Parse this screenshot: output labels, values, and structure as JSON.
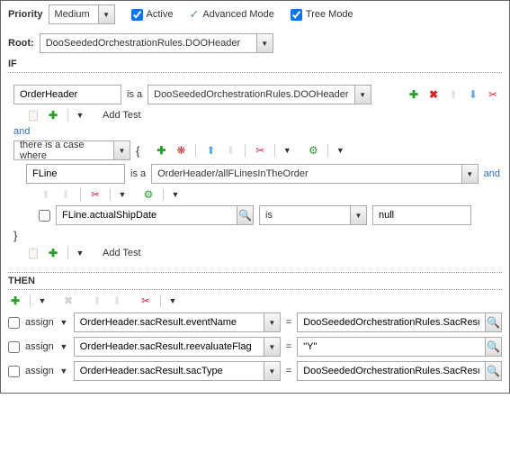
{
  "header": {
    "priority_label": "Priority",
    "priority_value": "Medium",
    "active_label": "Active",
    "advanced_label": "Advanced Mode",
    "tree_label": "Tree Mode"
  },
  "root": {
    "label": "Root:",
    "value": "DooSeededOrchestrationRules.DOOHeader"
  },
  "sections": {
    "if_label": "IF",
    "then_label": "THEN"
  },
  "if_block": {
    "header_var": "OrderHeader",
    "is_a": "is a",
    "header_type": "DooSeededOrchestrationRules.DOOHeader",
    "add_test": "Add Test",
    "and": "and",
    "case_where": "there is a case where",
    "lbrace": "{",
    "fline_var": "FLine",
    "fline_type": "OrderHeader/allFLinesInTheOrder",
    "and2": "and",
    "condition_field": "FLine.actualShipDate",
    "condition_op": "is",
    "condition_val": "null",
    "rbrace": "}"
  },
  "then_block": {
    "assign_label": "assign",
    "eq": "=",
    "rows": [
      {
        "target": "OrderHeader.sacResult.eventName",
        "value": "DooSeededOrchestrationRules.SacResult.S"
      },
      {
        "target": "OrderHeader.sacResult.reevaluateFlag",
        "value": "\"Y\""
      },
      {
        "target": "OrderHeader.sacResult.sacType",
        "value": "DooSeededOrchestrationRules.SacResult.S"
      }
    ]
  }
}
